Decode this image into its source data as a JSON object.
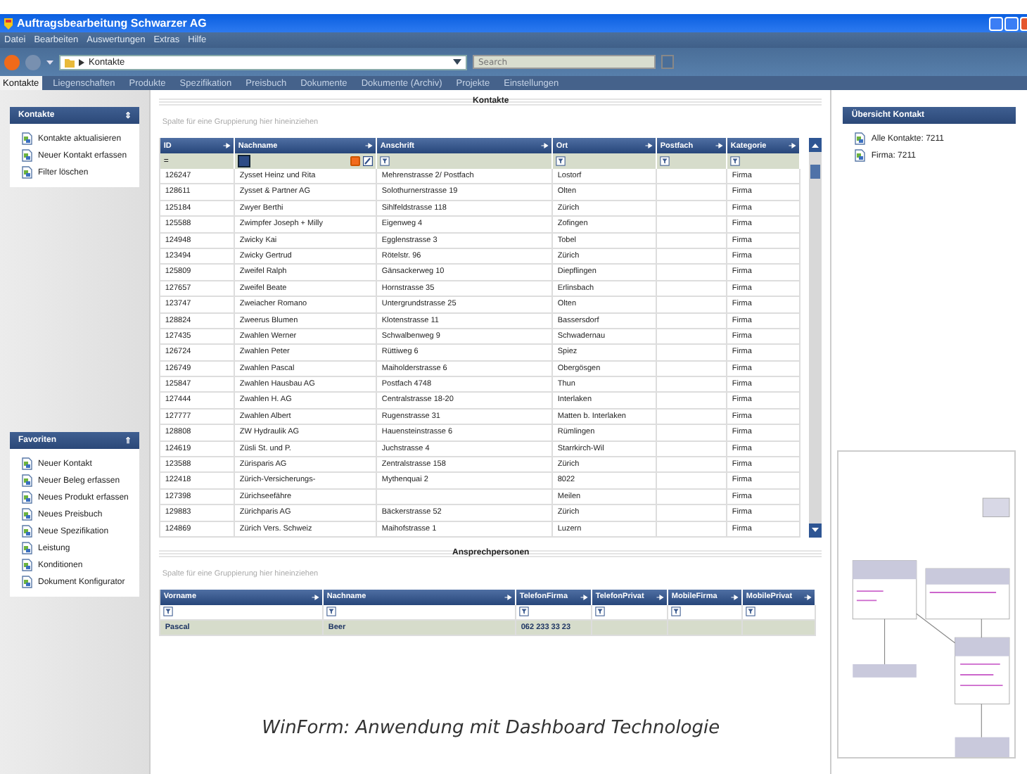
{
  "window": {
    "title": "Auftragsbearbeitung Schwarzer AG"
  },
  "menu": [
    "Datei",
    "Bearbeiten",
    "Auswertungen",
    "Extras",
    "Hilfe"
  ],
  "address": {
    "path": "Kontakte",
    "search_placeholder": "Search"
  },
  "tabs": [
    {
      "label": "Kontakte",
      "selected": true
    },
    {
      "label": "Liegenschaften",
      "selected": false
    },
    {
      "label": "Produkte",
      "selected": false
    },
    {
      "label": "Spezifikation",
      "selected": false
    },
    {
      "label": "Preisbuch",
      "selected": false
    },
    {
      "label": "Dokumente",
      "selected": false
    },
    {
      "label": "Dokumente (Archiv)",
      "selected": false
    },
    {
      "label": "Projekte",
      "selected": false
    },
    {
      "label": "Einstellungen",
      "selected": false
    }
  ],
  "sidebar": {
    "panels": [
      {
        "title": "Kontakte",
        "collapse_glyph": "⇕",
        "items": [
          "Kontakte aktualisieren",
          "Neuer Kontakt erfassen",
          "Filter löschen"
        ]
      },
      {
        "title": "Favoriten",
        "collapse_glyph": "⇑",
        "items": [
          "Neuer Kontakt",
          "Neuer Beleg erfassen",
          "Neues Produkt erfassen",
          "Neues Preisbuch",
          "Neue Spezifikation",
          "Leistung",
          "Konditionen",
          "Dokument Konfigurator"
        ]
      }
    ]
  },
  "contacts": {
    "title": "Kontakte",
    "group_hint": "Spalte für eine Gruppierung hier hineinziehen",
    "id_filter": "=",
    "columns": [
      "ID",
      "Nachname",
      "Anschrift",
      "Ort",
      "Postfach",
      "Kategorie"
    ],
    "rows": [
      {
        "id": "126247",
        "name": "Zysset Heinz und Rita",
        "address": "Mehrenstrasse 2/ Postfach",
        "city": "Lostorf",
        "category": "Firma"
      },
      {
        "id": "128611",
        "name": "Zysset & Partner AG",
        "address": "Solothurnerstrasse 19",
        "city": "Olten",
        "category": "Firma"
      },
      {
        "id": "125184",
        "name": "Zwyer Berthi",
        "address": "Sihlfeldstrasse 118",
        "city": "Zürich",
        "category": "Firma"
      },
      {
        "id": "125588",
        "name": "Zwimpfer Joseph + Milly",
        "address": "Eigenweg 4",
        "city": "Zofingen",
        "category": "Firma"
      },
      {
        "id": "124948",
        "name": "Zwicky Kai",
        "address": "Egglenstrasse 3",
        "city": "Tobel",
        "category": "Firma"
      },
      {
        "id": "123494",
        "name": "Zwicky Gertrud",
        "address": "Rötelstr. 96",
        "city": "Zürich",
        "category": "Firma"
      },
      {
        "id": "125809",
        "name": "Zweifel Ralph",
        "address": "Gänsackerweg 10",
        "city": "Diepflingen",
        "category": "Firma"
      },
      {
        "id": "127657",
        "name": "Zweifel Beate",
        "address": "Hornstrasse 35",
        "city": "Erlinsbach",
        "category": "Firma"
      },
      {
        "id": "123747",
        "name": "Zweiacher Romano",
        "address": "Untergrundstrasse 25",
        "city": "Olten",
        "category": "Firma"
      },
      {
        "id": "128824",
        "name": "Zweerus Blumen",
        "address": "Klotenstrasse 11",
        "city": "Bassersdorf",
        "category": "Firma"
      },
      {
        "id": "127435",
        "name": "Zwahlen Werner",
        "address": "Schwalbenweg 9",
        "city": "Schwadernau",
        "category": "Firma"
      },
      {
        "id": "126724",
        "name": "Zwahlen Peter",
        "address": "Rüttiweg 6",
        "city": "Spiez",
        "category": "Firma"
      },
      {
        "id": "126749",
        "name": "Zwahlen Pascal",
        "address": "Maiholderstrasse 6",
        "city": "Obergösgen",
        "category": "Firma"
      },
      {
        "id": "125847",
        "name": "Zwahlen Hausbau AG",
        "address": "Postfach 4748",
        "city": "Thun",
        "category": "Firma"
      },
      {
        "id": "127444",
        "name": "Zwahlen H. AG",
        "address": "Centralstrasse 18-20",
        "city": "Interlaken",
        "category": "Firma"
      },
      {
        "id": "127777",
        "name": "Zwahlen Albert",
        "address": "Rugenstrasse 31",
        "city": "Matten b. Interlaken",
        "category": "Firma"
      },
      {
        "id": "128808",
        "name": "ZW Hydraulik AG",
        "address": "Hauensteinstrasse 6",
        "city": "Rümlingen",
        "category": "Firma"
      },
      {
        "id": "124619",
        "name": "Züsli St. und P.",
        "address": "Juchstrasse 4",
        "city": "Starrkirch-Wil",
        "category": "Firma"
      },
      {
        "id": "123588",
        "name": "Zürisparis AG",
        "address": "Zentralstrasse 158",
        "city": "Zürich",
        "category": "Firma"
      },
      {
        "id": "122418",
        "name": "Zürich-Versicherungs-",
        "address": "Mythenquai 2",
        "city": "8022",
        "category": "Firma"
      },
      {
        "id": "127398",
        "name": "Zürichseefähre",
        "city": "Meilen",
        "category": "Firma"
      },
      {
        "id": "129883",
        "name": "Zürichparis AG",
        "address": "Bäckerstrasse 52",
        "city": "Zürich",
        "category": "Firma"
      },
      {
        "id": "124869",
        "name": "Zürich Vers. Schweiz",
        "address": "Maihofstrasse 1",
        "city": "Luzern",
        "category": "Firma"
      }
    ]
  },
  "persons": {
    "title": "Ansprechpersonen",
    "group_hint": "Spalte für eine Gruppierung hier hineinziehen",
    "columns": [
      "Vorname",
      "Nachname",
      "TelefonFirma",
      "TelefonPrivat",
      "MobileFirma",
      "MobilePrivat"
    ],
    "rows": [
      {
        "selected": true,
        "cells": [
          "Pascal",
          "Beer",
          "062 233 33 23"
        ]
      }
    ]
  },
  "caption": "WinForm: Anwendung mit Dashboard Technologie",
  "overview": {
    "title": "Übersicht Kontakt",
    "items": [
      "Alle Kontakte: 7211",
      "Firma: 7211"
    ]
  }
}
